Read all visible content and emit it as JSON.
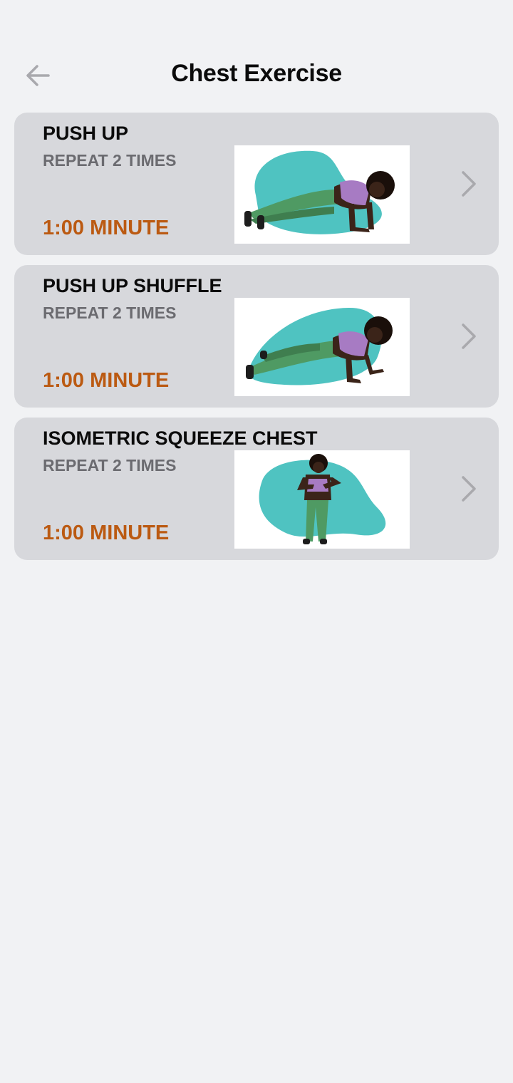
{
  "header": {
    "title": "Chest Exercise",
    "back_icon": "arrow-left-icon"
  },
  "exercises": [
    {
      "name": "PUSH UP",
      "repeat": "REPEAT 2 TIMES",
      "duration": "1:00 MINUTE",
      "image": "push-up-illustration"
    },
    {
      "name": "PUSH UP SHUFFLE",
      "repeat": "REPEAT 2 TIMES",
      "duration": "1:00 MINUTE",
      "image": "push-up-shuffle-illustration"
    },
    {
      "name": "ISOMETRIC SQUEEZE CHEST",
      "repeat": "REPEAT 2 TIMES",
      "duration": "1:00 MINUTE",
      "image": "isometric-squeeze-chest-illustration"
    }
  ],
  "colors": {
    "background": "#f1f2f4",
    "card": "#d7d8dc",
    "duration_text": "#bb5a12",
    "blob": "#4fc3c1",
    "leggings": "#4f9a63",
    "top": "#a77bc3",
    "skin": "#3b2419"
  }
}
